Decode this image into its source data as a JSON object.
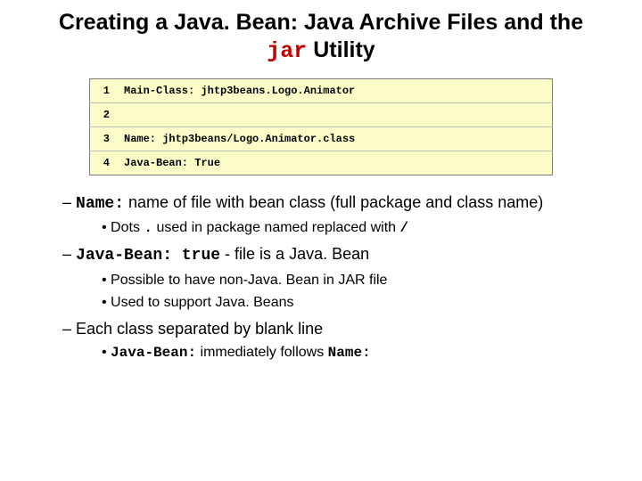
{
  "title": {
    "prefix": "Creating a Java. Bean: Java Archive Files and the ",
    "code": "jar",
    "suffix": " Utility"
  },
  "code": {
    "rows": [
      {
        "n": "1",
        "text": "Main-Class: jhtp3beans.Logo.Animator"
      },
      {
        "n": "2",
        "text": " "
      },
      {
        "n": "3",
        "text": "Name: jhtp3beans/Logo.Animator.class"
      },
      {
        "n": "4",
        "text": "Java-Bean: True"
      }
    ]
  },
  "b1": {
    "code": "Name:",
    "rest": " name of file with bean class (full package and class name)"
  },
  "b1a": {
    "pre": "Dots ",
    "dot": ".",
    "mid": " used in package named replaced with ",
    "slash": "/"
  },
  "b2": {
    "code": "Java-Bean: true",
    "rest": " - file is a Java. Bean"
  },
  "b2a": "Possible to have non-Java. Bean in JAR file",
  "b2b": "Used to support Java. Beans",
  "b3": "Each class separated by blank line",
  "b3a": {
    "code": "Java-Bean:",
    "mid": " immediately follows ",
    "code2": "Name:"
  }
}
